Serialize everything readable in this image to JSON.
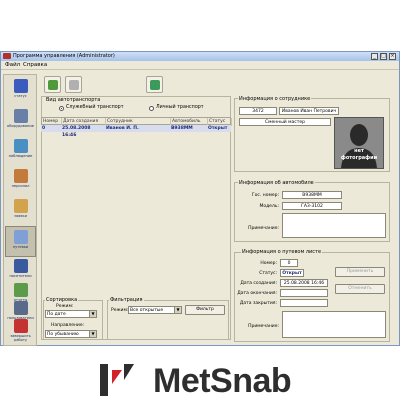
{
  "window": {
    "title": "Программа управления (Administrator)",
    "buttons": [
      "_",
      "□",
      "×"
    ]
  },
  "menu": [
    "Файл",
    "Справка"
  ],
  "sidebar": {
    "items": [
      {
        "label": "статус",
        "icon": "person-icon",
        "color": "#3b5bbd"
      },
      {
        "label": "оборудование",
        "icon": "hardware-icon",
        "color": "#6a7fa8"
      },
      {
        "label": "наблюдение",
        "icon": "monitor-icon",
        "color": "#4a8fc4"
      },
      {
        "label": "персонал",
        "icon": "staff-icon",
        "color": "#c47a3a"
      },
      {
        "label": "заявки",
        "icon": "requests-icon",
        "color": "#d3a24c"
      },
      {
        "label": "путевки",
        "icon": "waybill-icon",
        "color": "#7f9fd6"
      },
      {
        "label": "посетители",
        "icon": "visitors-icon",
        "color": "#3a5aa0"
      },
      {
        "label": "отчеты",
        "icon": "reports-icon",
        "color": "#5b9b4a"
      },
      {
        "label": "пользователи",
        "icon": "users-icon",
        "color": "#5a6a8a"
      },
      {
        "label": "завершить работу",
        "icon": "exit-icon",
        "color": "#c43232"
      }
    ]
  },
  "toolbar": {
    "buttons": [
      {
        "name": "add-waybill-button",
        "icon": "document-add-icon",
        "color": "#4f9a3d"
      },
      {
        "name": "edit-waybill-button",
        "icon": "document-edit-icon",
        "color": "#b0b0b0"
      },
      {
        "name": "refresh-button",
        "icon": "refresh-icon",
        "color": "#3c9a5a"
      }
    ]
  },
  "transport": {
    "group_label": "Вид автотранспорта",
    "options": [
      "Служебный транспорт",
      "Личный транспорт"
    ],
    "selected": 0
  },
  "grid": {
    "columns": [
      "Номер",
      "Дата создания",
      "Сотрудник",
      "Автомобиль",
      "Статус"
    ],
    "rows": [
      [
        "0",
        "25.08.2008 16:46",
        "Иванов И. П.",
        "В938ММ",
        "Открыт"
      ]
    ]
  },
  "sorting": {
    "group_label": "Сортировка",
    "field_label": "Режим:",
    "field_value": "По дате",
    "direction_label": "Направление:",
    "direction_value": "По убыванию"
  },
  "filter": {
    "group_label": "Фильтрация",
    "mode_label": "Режим:",
    "mode_value": "Все открытые",
    "button": "Фильтр"
  },
  "employee": {
    "group_label": "Информация о сотруднике",
    "id": "3472",
    "name": "Иванов Иван Петрович",
    "position": "Сменный мастер",
    "photo_text_1": "нет",
    "photo_text_2": "фотографии"
  },
  "vehicle": {
    "group_label": "Информация об автомобиле",
    "plate_label": "Гос. номер:",
    "plate": "В938ММ",
    "model_label": "Модель:",
    "model": "ГАЗ-3102",
    "note_label": "Примечание:"
  },
  "waybill": {
    "group_label": "Информация о путевом листе",
    "number_label": "Номер:",
    "number": "0",
    "status_label": "Статус:",
    "status": "Открыт",
    "created_label": "Дата создания:",
    "created": "25.08.2008 16:46",
    "returned_label": "Дата окончания:",
    "closed_label": "Дата закрытия:",
    "note_label": "Примечание:",
    "apply_button": "Применить",
    "cancel_button": "Отменить"
  },
  "brand": {
    "name": "MetSnab",
    "colors": {
      "dark": "#2e2e2e",
      "red": "#d2232a"
    }
  }
}
